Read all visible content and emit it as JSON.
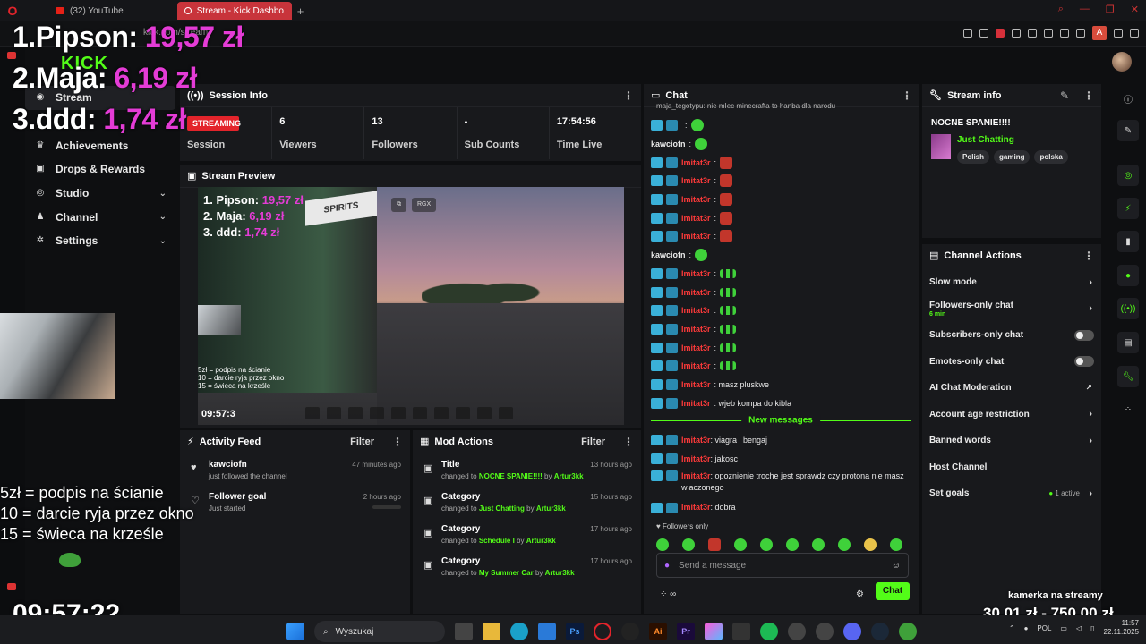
{
  "browser": {
    "tabs": [
      {
        "label": "(32) YouTube"
      },
      {
        "label": "Stream - Kick Dashbo"
      }
    ],
    "url": "kick.com/stream"
  },
  "app": {
    "logo": "KICK"
  },
  "nav": {
    "items": [
      {
        "label": "Stream",
        "icon": "stream-icon"
      },
      {
        "label": "Achievements",
        "icon": "trophy-icon"
      },
      {
        "label": "Drops & Rewards",
        "icon": "gift-icon"
      },
      {
        "label": "Studio",
        "icon": "studio-icon"
      },
      {
        "label": "Channel",
        "icon": "channel-icon"
      },
      {
        "label": "Settings",
        "icon": "gear-icon"
      }
    ]
  },
  "session": {
    "title": "Session Info",
    "status_badge": "STREAMING",
    "stats": [
      {
        "value": "",
        "label": "Session"
      },
      {
        "value": "6",
        "label": "Viewers"
      },
      {
        "value": "13",
        "label": "Followers"
      },
      {
        "value": "-",
        "label": "Sub Counts"
      },
      {
        "value": "17:54:56",
        "label": "Time Live"
      }
    ]
  },
  "preview": {
    "title": "Stream Preview",
    "leaderboard": [
      {
        "name": "1. Pipson: ",
        "amount": "19,57 zł"
      },
      {
        "name": "2. Maja: ",
        "amount": "6,19 zł"
      },
      {
        "name": "3. ddd: ",
        "amount": "1,74 zł"
      }
    ],
    "rules": [
      "5zł = podpis na ścianie",
      "10 = darcie ryja przez okno",
      "15 = świeca na krześle"
    ],
    "sign_text": "SPIRITS",
    "time": "09:57:3",
    "ctrl_label": "RGX"
  },
  "activity": {
    "title": "Activity Feed",
    "filter": "Filter",
    "items": [
      {
        "title": "kawciofn",
        "sub": "just followed the channel",
        "time": "47 minutes ago"
      },
      {
        "title": "Follower goal",
        "sub": "Just started",
        "time": "2 hours ago"
      }
    ]
  },
  "mod": {
    "title": "Mod Actions",
    "filter": "Filter",
    "items": [
      {
        "title": "Title",
        "pre": "changed to ",
        "value": "NOCNE SPANIE!!!!",
        "by": " by ",
        "user": "Artur3kk",
        "time": "13 hours ago"
      },
      {
        "title": "Category",
        "pre": "changed to ",
        "value": "Just Chatting",
        "by": " by ",
        "user": "Artur3kk",
        "time": "15 hours ago"
      },
      {
        "title": "Category",
        "pre": "changed to ",
        "value": "Schedule I",
        "by": " by ",
        "user": "Artur3kk",
        "time": "17 hours ago"
      },
      {
        "title": "Category",
        "pre": "changed to ",
        "value": "My Summer Car",
        "by": " by ",
        "user": "Artur3kk",
        "time": "17 hours ago"
      }
    ]
  },
  "chat": {
    "title": "Chat",
    "top_line": "maja_tegotypu: nie mIec minecrafta to hanba dla narodu",
    "messages": [
      {
        "user": "",
        "text": ":",
        "emote": "g"
      },
      {
        "user": "kawciofn",
        "text": ":",
        "emote": "g",
        "plain": true
      },
      {
        "user": "lmitat3r",
        "text": ":",
        "emote": "r"
      },
      {
        "user": "lmitat3r",
        "text": ":",
        "emote": "r"
      },
      {
        "user": "lmitat3r",
        "text": ":",
        "emote": "r"
      },
      {
        "user": "lmitat3r",
        "text": ":",
        "emote": "r"
      },
      {
        "user": "lmitat3r",
        "text": ":",
        "emote": "r"
      },
      {
        "user": "kawciofn",
        "text": ":",
        "emote": "g",
        "plain": true
      },
      {
        "user": "lmitat3r",
        "text": ":",
        "emote": "bars"
      },
      {
        "user": "lmitat3r",
        "text": ":",
        "emote": "bars"
      },
      {
        "user": "lmitat3r",
        "text": ":",
        "emote": "bars"
      },
      {
        "user": "lmitat3r",
        "text": ":",
        "emote": "bars"
      },
      {
        "user": "lmitat3r",
        "text": ":",
        "emote": "bars"
      },
      {
        "user": "lmitat3r",
        "text": ":",
        "emote": "bars"
      },
      {
        "user": "lmitat3r",
        "text": ": masz pluskwe",
        "emote": ""
      },
      {
        "user": "lmitat3r",
        "text": ": wjeb kompa do kibla",
        "emote": ""
      }
    ],
    "new_messages_label": "New messages",
    "new_messages": [
      {
        "user": "lmitat3r",
        "text": ": viagra i bengaj"
      },
      {
        "user": "lmitat3r",
        "text": ": jakosc"
      },
      {
        "user": "lmitat3r",
        "text": ": opoznienie troche jest sprawdz czy protona nie masz wlaczonego"
      },
      {
        "user": "lmitat3r",
        "text": ": dobra"
      }
    ],
    "followers_only": "Followers only",
    "input_placeholder": "Send a message",
    "send_label": "Chat"
  },
  "stream_info": {
    "title": "Stream info",
    "stream_title": "NOCNE SPANIE!!!!",
    "category": "Just Chatting",
    "tags": [
      "Polish",
      "gaming",
      "polska"
    ]
  },
  "channel_actions": {
    "title": "Channel Actions",
    "items": [
      {
        "label": "Slow mode",
        "control": "arrow"
      },
      {
        "label": "Followers-only chat",
        "sub": "6 min",
        "control": "arrow"
      },
      {
        "label": "Subscribers-only chat",
        "control": "toggle"
      },
      {
        "label": "Emotes-only chat",
        "control": "toggle"
      },
      {
        "label": "AI Chat Moderation",
        "control": "external"
      },
      {
        "label": "Account age restriction",
        "control": "arrow"
      },
      {
        "label": "Banned words",
        "control": "arrow"
      },
      {
        "label": "Host Channel",
        "control": "none"
      },
      {
        "label": "Set goals",
        "status": "1 active",
        "control": "arrow"
      }
    ]
  },
  "overlay": {
    "leaderboard": [
      {
        "name": "1.Pipson: ",
        "amount": "19,57 zł"
      },
      {
        "name": "2.Maja: ",
        "amount": "6,19 zł"
      },
      {
        "name": "3.ddd: ",
        "amount": "1,74 zł"
      }
    ],
    "rules": [
      "5zł = podpis na ścianie",
      "10 = darcie ryja przez okno",
      "15 = świeca na krześle"
    ],
    "clock": "09:57:22",
    "goal_title": "kamerka na streamy",
    "goal_value": "30,01 zł - 750,00 zł"
  },
  "taskbar": {
    "search_placeholder": "Wyszukaj",
    "lang": "POL",
    "time": "11:57",
    "date": "22.11.2025"
  },
  "colors": {
    "accent": "#53fc18",
    "live": "#e3242b",
    "donation": "#e43cd6",
    "mod_user": "#ff3a3a"
  }
}
